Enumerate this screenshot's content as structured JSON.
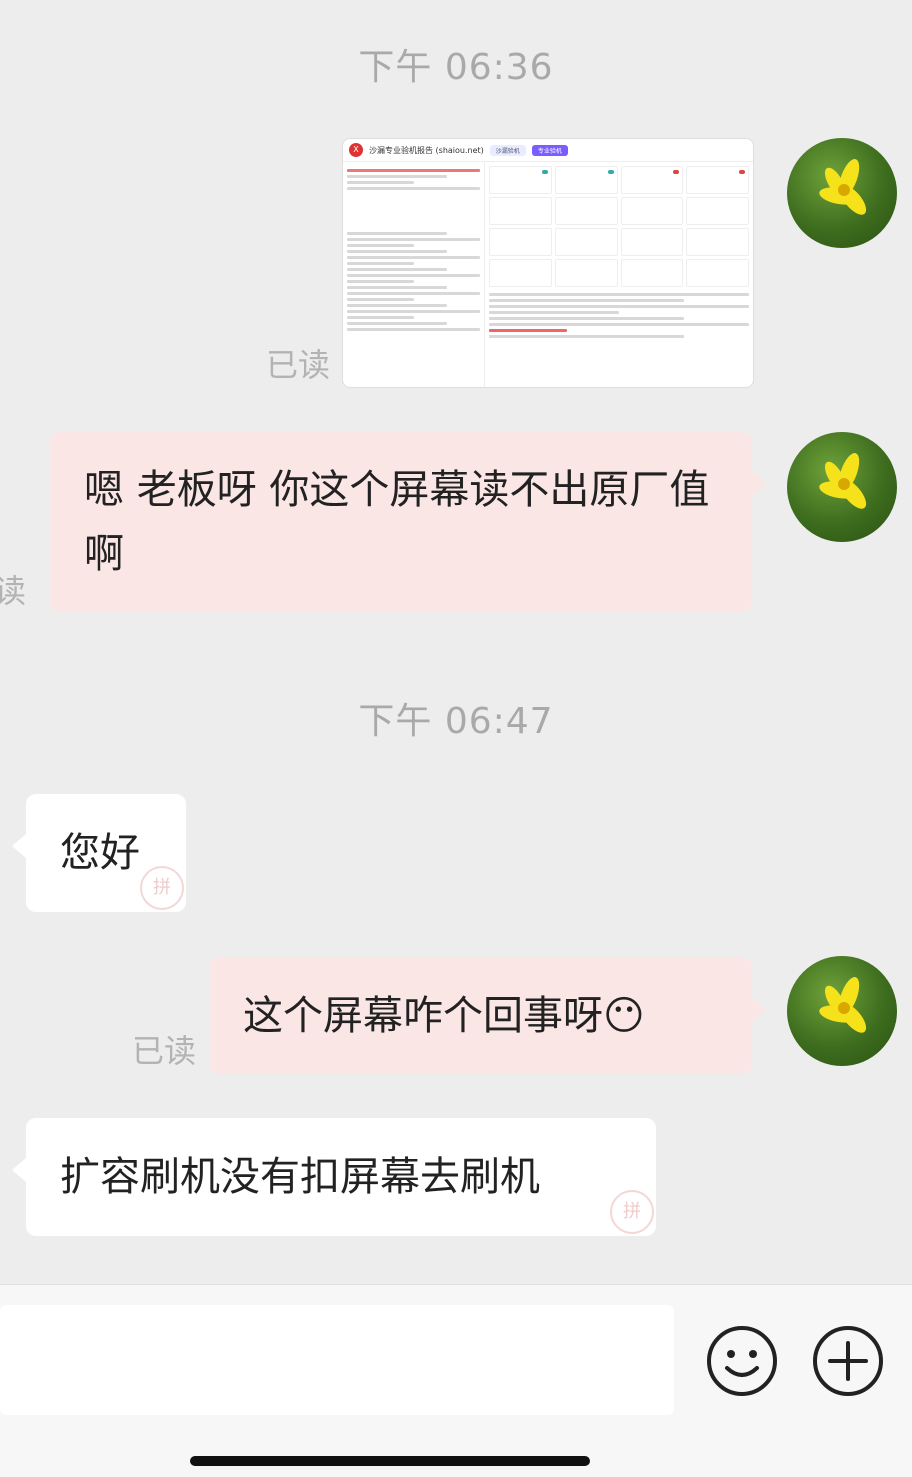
{
  "messages": {
    "time1": "下午 06:36",
    "read_label": "已读",
    "image_title": "沙漏专业验机报告 (shaiou.net)",
    "image_tab1": "沙漏验机",
    "image_tab2": "专业验机",
    "msg1": "嗯 老板呀 你这个屏幕读不出原厂值啊",
    "time2": "下午 06:47",
    "msg2": "您好",
    "msg3": "这个屏幕咋个回事呀😶",
    "msg4": "扩容刷机没有扣屏幕去刷机",
    "partial_read": "读",
    "stamp_text": "拼"
  },
  "input_bar": {
    "emoji_icon": "smile-icon",
    "plus_icon": "plus-icon"
  },
  "colors": {
    "background": "#ededed",
    "self_bubble": "#fbe6e6",
    "other_bubble": "#ffffff",
    "time_text": "#a9a9a9"
  }
}
